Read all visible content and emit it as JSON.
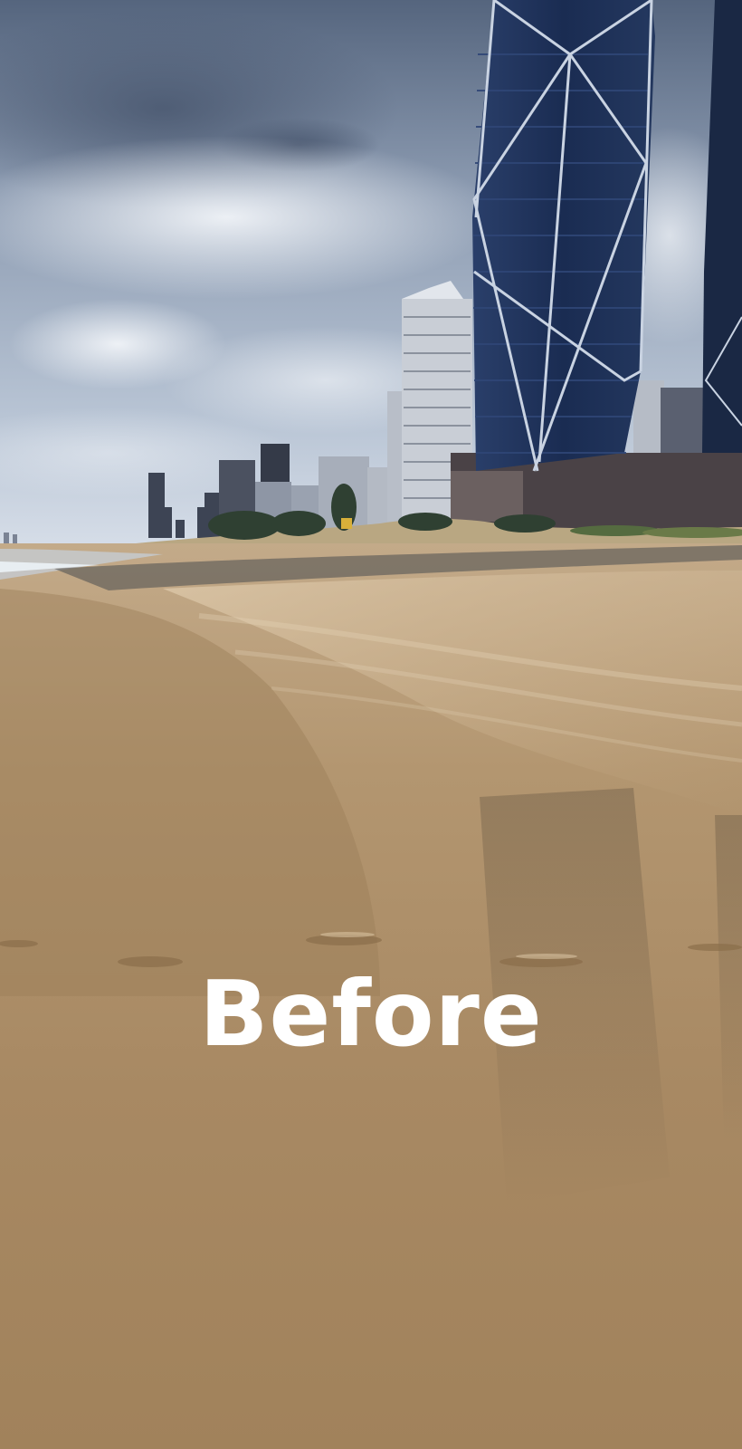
{
  "overlay_text": "Before",
  "colors": {
    "sky_top": "#5f6f86",
    "sky_mid": "#a9b6c8",
    "sky_horizon": "#dfe6ee",
    "tower_glass": "#1c2f55",
    "tower_frame": "#c9d3e2",
    "wet_sand": "#a5865e",
    "dry_sand": "#cdb28f",
    "caption": "#ffffff"
  }
}
